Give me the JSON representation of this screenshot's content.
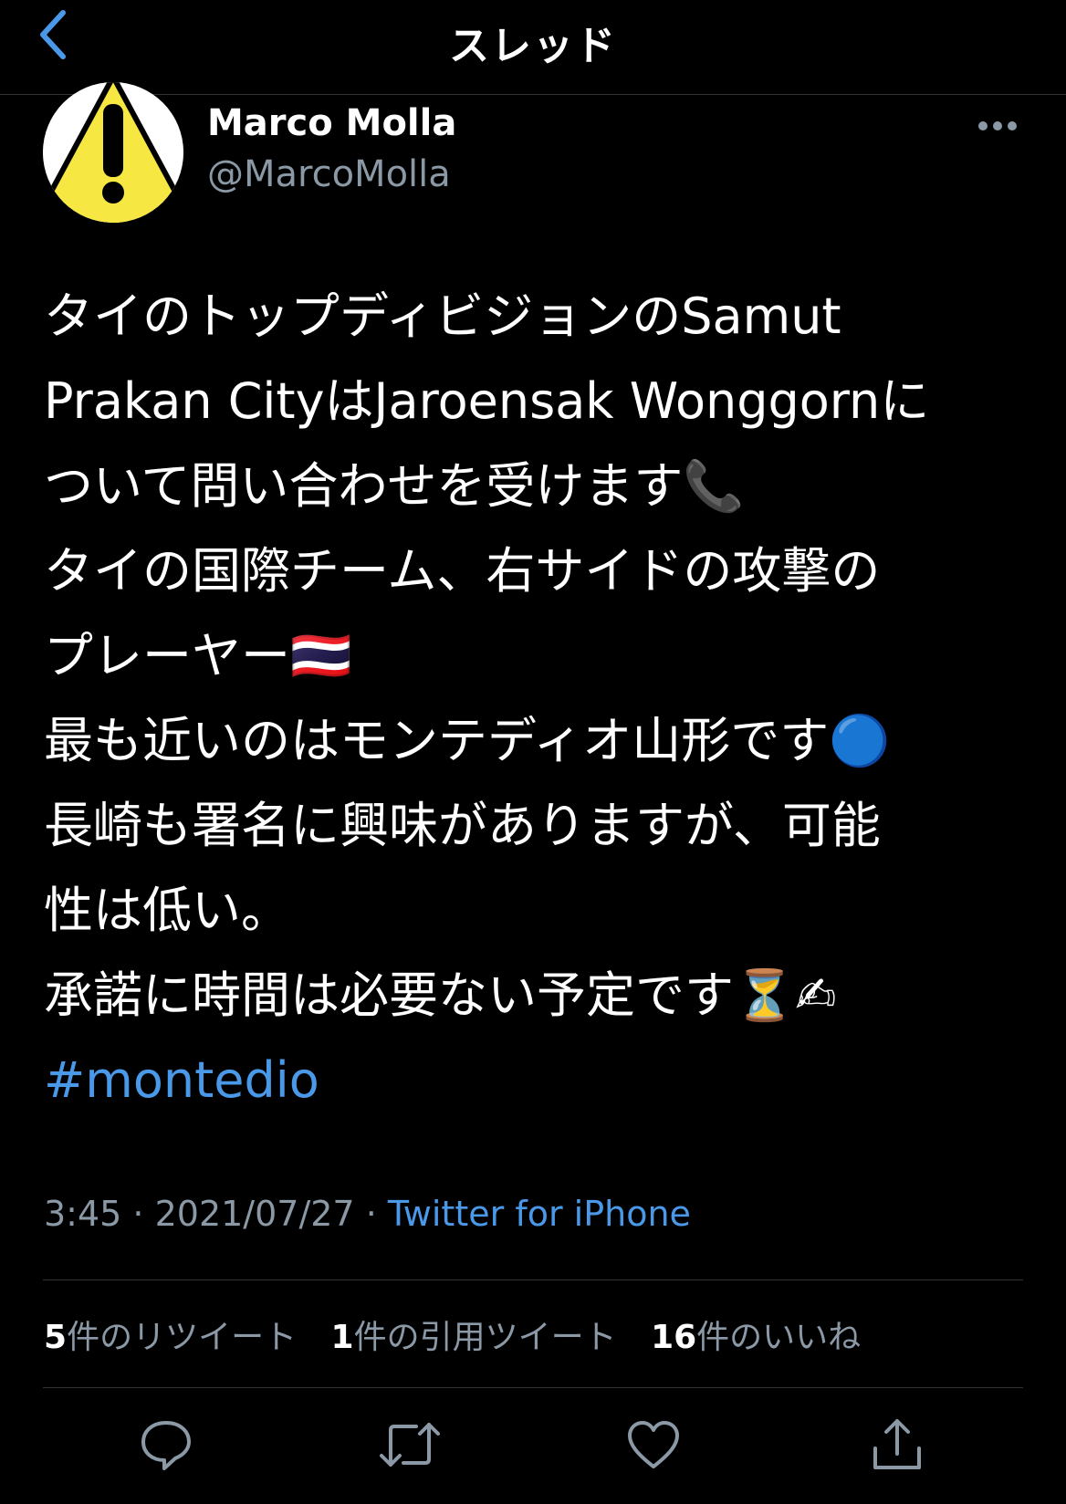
{
  "header": {
    "title": "スレッド"
  },
  "colors": {
    "background": "#000000",
    "accent": "#4a99e9",
    "secondary_text": "#8b98a5",
    "divider": "#2f3336",
    "avatar_yellow": "#f7e742"
  },
  "icons": {
    "back": "chevron-left-icon",
    "more": "more-horizontal-icon",
    "reply": "reply-icon",
    "retweet": "retweet-icon",
    "like": "heart-icon",
    "share": "share-icon",
    "avatar": "warning-sign-icon"
  },
  "tweet": {
    "author_name": "Marco Molla",
    "author_handle": "@MarcoMolla",
    "lines": [
      "タイのトップディビジョンのSamut",
      "Prakan CityはJaroensak Wonggornに",
      "ついて問い合わせを受けます📞",
      "タイの国際チーム、右サイドの攻撃の",
      "プレーヤー🇹🇭",
      "最も近いのはモンテディオ山形です🔵",
      "長崎も署名に興味がありますが、可能",
      "性は低い。",
      "承諾に時間は必要ない予定です⏳✍"
    ],
    "hashtag": "#montedio",
    "time": "3:45",
    "date": "2021/07/27",
    "separator": " · ",
    "source": "Twitter for iPhone"
  },
  "stats": {
    "retweets_count": "5",
    "retweets_label": "件のリツイート",
    "quotes_count": "1",
    "quotes_label": "件の引用ツイート",
    "likes_count": "16",
    "likes_label": "件のいいね"
  }
}
